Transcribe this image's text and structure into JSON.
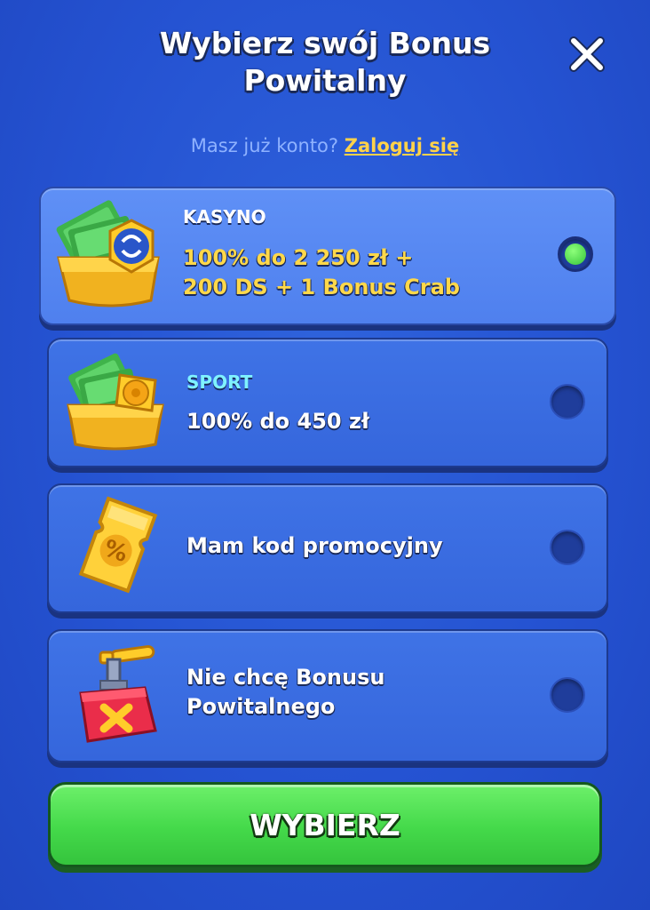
{
  "header": {
    "title": "Wybierz swój Bonus Powitalny",
    "close_icon": "close-icon"
  },
  "login": {
    "question": "Masz już konto?",
    "link": "Zaloguj się"
  },
  "options": [
    {
      "category": "KASYNO",
      "category_color": "#ffffff",
      "offer_line1": "100% do 2 250 zł +",
      "offer_line2": "200 DS + 1 Bonus Crab",
      "offer_color": "#ffd84a",
      "icon": "cash-box-coin-icon",
      "selected": true
    },
    {
      "category": "SPORT",
      "category_color": "#7ff2ff",
      "offer_line1": "100% do 450 zł",
      "offer_line2": "",
      "offer_color": "#ffffff",
      "icon": "cash-box-ball-icon",
      "selected": false
    },
    {
      "category": "",
      "offer_line1": "Mam kod promocyjny",
      "offer_line2": "",
      "offer_color": "#ffffff",
      "icon": "promo-ticket-icon",
      "selected": false
    },
    {
      "category": "",
      "offer_line1": "Nie chcę Bonusu",
      "offer_line2": "Powitalnego",
      "offer_color": "#ffffff",
      "icon": "detonator-box-icon",
      "selected": false
    }
  ],
  "cta": {
    "label": "WYBIERZ"
  },
  "colors": {
    "background": "#2553d2",
    "selected_dot": "#3ed043",
    "cta": "#44d94a",
    "accent_yellow": "#ffd84a"
  }
}
